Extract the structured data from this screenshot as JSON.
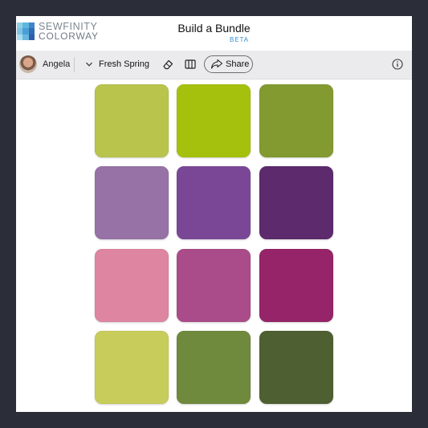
{
  "brand": {
    "line1": "SEWFINITY",
    "line2": "COLORWAY",
    "grid_colors": [
      "#8fd0e8",
      "#5fb6de",
      "#3f86c8",
      "#7fc3e6",
      "#4a9fd6",
      "#2f6fb4",
      "#a8dcf0",
      "#6ab8e0",
      "#2f5fa8"
    ]
  },
  "header": {
    "title": "Build a Bundle",
    "badge": "BETA"
  },
  "toolbar": {
    "user_name": "Angela",
    "palette_name": "Fresh Spring",
    "share_label": "Share"
  },
  "swatches": [
    [
      "#b9c44c",
      "#a6c10d",
      "#839a30"
    ],
    [
      "#9672a6",
      "#7a4797",
      "#5d2a6d"
    ],
    [
      "#de86a1",
      "#ab4c8a",
      "#952468"
    ],
    [
      "#c8cc5b",
      "#6f8a3c",
      "#4e5f31"
    ]
  ],
  "colors": {
    "accent": "#2d8fd4",
    "toolbar_bg": "#ebebed",
    "outer_bg": "#2b2d38"
  }
}
